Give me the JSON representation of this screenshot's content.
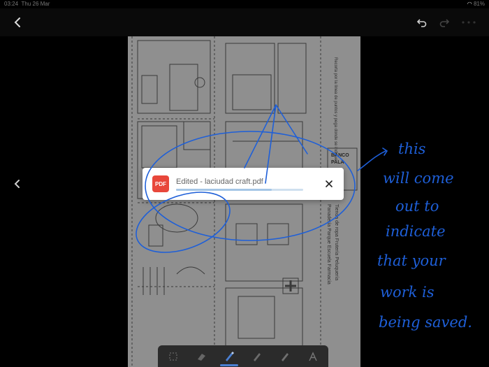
{
  "status_bar": {
    "time": "03:24",
    "date": "Thu 26 Mar",
    "battery": "81%"
  },
  "document": {
    "file_name": "Edited - laciudad craft.pdf"
  },
  "toast": {
    "pdf_badge": "PDF",
    "title": "Edited - laciudad craft.pdf",
    "progress": 0.75
  },
  "page_text": {
    "vertical_instruction": "Recorta por la línea de puntos y pega donde se indique",
    "vertical_places_1": "Panadería Parque Escuela Farmacia",
    "vertical_places_2": "Tienda de ropa Frutería Peluquería",
    "label_fragments": [
      "BANCO",
      "PALA"
    ]
  },
  "annotation": {
    "handwritten_note": [
      "this",
      "will come",
      "out to",
      "indicate",
      "that your",
      "work is",
      "being saved."
    ],
    "ink_color": "#1e5fd8"
  },
  "colors": {
    "accent": "#4a7fd2",
    "pdf_red": "#e8473b"
  },
  "icons": {
    "back": "chevron-left-icon",
    "undo": "undo-icon",
    "redo": "redo-icon",
    "side_back": "chevron-left-icon",
    "close": "close-icon",
    "tools": [
      "lasso-select-icon",
      "eraser-icon",
      "pen-icon",
      "pencil-icon",
      "marker-icon",
      "text-icon"
    ]
  }
}
